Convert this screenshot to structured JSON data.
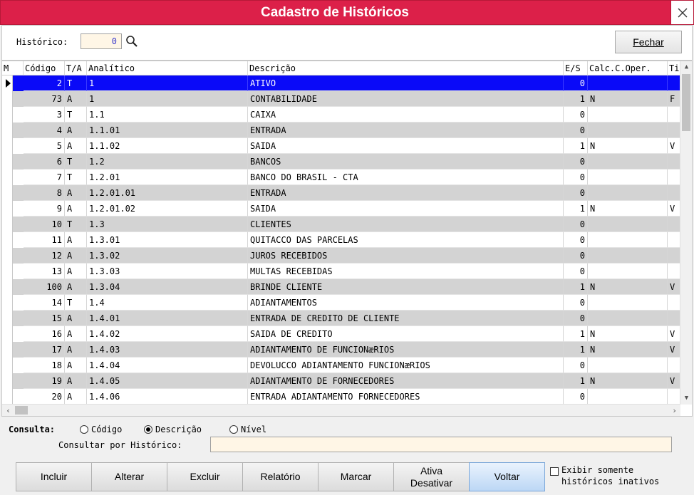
{
  "window": {
    "title": "Cadastro de Históricos"
  },
  "toolbar": {
    "historico_label": "Histórico:",
    "historico_value": "0",
    "fechar_label": "Fechar"
  },
  "grid": {
    "columns": [
      "M",
      "Código",
      "T/A",
      "Analítico",
      "Descrição",
      "E/S",
      "Calc.C.Oper.",
      "Ti"
    ],
    "rows": [
      {
        "codigo": "2",
        "ta": "T",
        "analitico": "1",
        "descricao": "ATIVO",
        "es": "0",
        "calc": "",
        "ti": ""
      },
      {
        "codigo": "73",
        "ta": "A",
        "analitico": "1",
        "descricao": "CONTABILIDADE",
        "es": "1",
        "calc": "N",
        "ti": "F"
      },
      {
        "codigo": "3",
        "ta": "T",
        "analitico": "1.1",
        "descricao": "CAIXA",
        "es": "0",
        "calc": "",
        "ti": ""
      },
      {
        "codigo": "4",
        "ta": "A",
        "analitico": "1.1.01",
        "descricao": "ENTRADA",
        "es": "0",
        "calc": "",
        "ti": ""
      },
      {
        "codigo": "5",
        "ta": "A",
        "analitico": "1.1.02",
        "descricao": "SAIDA",
        "es": "1",
        "calc": "N",
        "ti": "V"
      },
      {
        "codigo": "6",
        "ta": "T",
        "analitico": "1.2",
        "descricao": "BANCOS",
        "es": "0",
        "calc": "",
        "ti": ""
      },
      {
        "codigo": "7",
        "ta": "T",
        "analitico": "1.2.01",
        "descricao": "BANCO DO BRASIL - CTA",
        "es": "0",
        "calc": "",
        "ti": ""
      },
      {
        "codigo": "8",
        "ta": "A",
        "analitico": "1.2.01.01",
        "descricao": "ENTRADA",
        "es": "0",
        "calc": "",
        "ti": ""
      },
      {
        "codigo": "9",
        "ta": "A",
        "analitico": "1.2.01.02",
        "descricao": "SAIDA",
        "es": "1",
        "calc": "N",
        "ti": "V"
      },
      {
        "codigo": "10",
        "ta": "T",
        "analitico": "1.3",
        "descricao": "CLIENTES",
        "es": "0",
        "calc": "",
        "ti": ""
      },
      {
        "codigo": "11",
        "ta": "A",
        "analitico": "1.3.01",
        "descricao": "QUITACCO DAS PARCELAS",
        "es": "0",
        "calc": "",
        "ti": ""
      },
      {
        "codigo": "12",
        "ta": "A",
        "analitico": "1.3.02",
        "descricao": "JUROS RECEBIDOS",
        "es": "0",
        "calc": "",
        "ti": ""
      },
      {
        "codigo": "13",
        "ta": "A",
        "analitico": "1.3.03",
        "descricao": "MULTAS RECEBIDAS",
        "es": "0",
        "calc": "",
        "ti": ""
      },
      {
        "codigo": "100",
        "ta": "A",
        "analitico": "1.3.04",
        "descricao": "BRINDE CLIENTE",
        "es": "1",
        "calc": "N",
        "ti": "V"
      },
      {
        "codigo": "14",
        "ta": "T",
        "analitico": "1.4",
        "descricao": "ADIANTAMENTOS",
        "es": "0",
        "calc": "",
        "ti": ""
      },
      {
        "codigo": "15",
        "ta": "A",
        "analitico": "1.4.01",
        "descricao": "ENTRADA DE CREDITO DE CLIENTE",
        "es": "0",
        "calc": "",
        "ti": ""
      },
      {
        "codigo": "16",
        "ta": "A",
        "analitico": "1.4.02",
        "descricao": "SAIDA DE CREDITO",
        "es": "1",
        "calc": "N",
        "ti": "V"
      },
      {
        "codigo": "17",
        "ta": "A",
        "analitico": "1.4.03",
        "descricao": "ADIANTAMENTO DE FUNCIONæRIOS",
        "es": "1",
        "calc": "N",
        "ti": "V"
      },
      {
        "codigo": "18",
        "ta": "A",
        "analitico": "1.4.04",
        "descricao": "DEVOLUCCO ADIANTAMENTO FUNCIONæRIOS",
        "es": "0",
        "calc": "",
        "ti": ""
      },
      {
        "codigo": "19",
        "ta": "A",
        "analitico": "1.4.05",
        "descricao": "ADIANTAMENTO DE FORNECEDORES",
        "es": "1",
        "calc": "N",
        "ti": "V"
      },
      {
        "codigo": "20",
        "ta": "A",
        "analitico": "1.4.06",
        "descricao": "ENTRADA ADIANTAMENTO FORNECEDORES",
        "es": "0",
        "calc": "",
        "ti": ""
      }
    ],
    "selected_index": 0
  },
  "consulta": {
    "label": "Consulta:",
    "options": [
      "Código",
      "Descrição",
      "Nível"
    ],
    "selected": "Descrição",
    "por_label": "Consultar por Histórico:",
    "por_value": ""
  },
  "buttons": {
    "incluir": "Incluir",
    "alterar": "Alterar",
    "excluir": "Excluir",
    "relatorio": "Relatório",
    "marcar": "Marcar",
    "ativa_line1": "Ativa",
    "ativa_line2": "Desativar",
    "voltar": "Voltar"
  },
  "inativos": {
    "line1": "Exibir somente",
    "line2": "históricos inativos",
    "checked": false
  },
  "colors": {
    "title_bar": "#dc2049",
    "selected_row": "#0a0af8",
    "alt_row": "#d3d3d3",
    "input_bg": "#fff6e6"
  }
}
